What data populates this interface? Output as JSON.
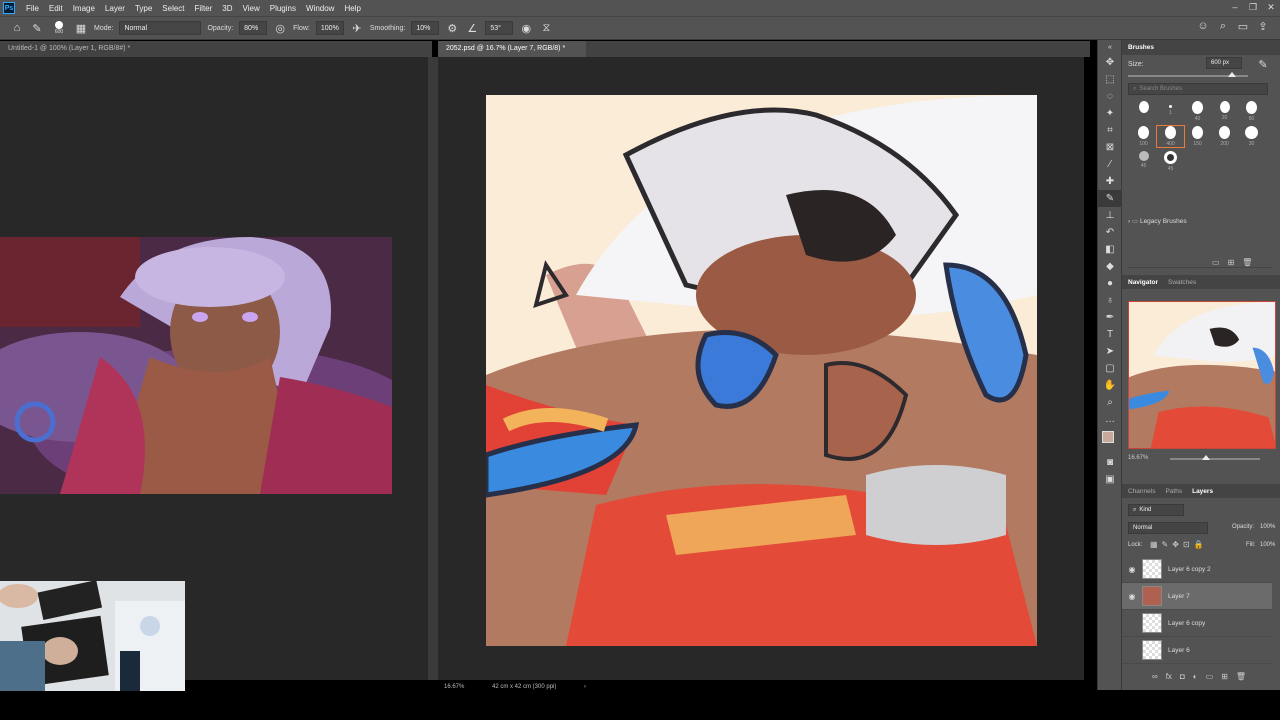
{
  "menu": [
    "File",
    "Edit",
    "Image",
    "Layer",
    "Type",
    "Select",
    "Filter",
    "3D",
    "View",
    "Plugins",
    "Window",
    "Help"
  ],
  "options": {
    "brush_size": "600",
    "mode_label": "Mode:",
    "mode_value": "Normal",
    "opacity_label": "Opacity:",
    "opacity_value": "80%",
    "flow_label": "Flow:",
    "flow_value": "100%",
    "smoothing_label": "Smoothing:",
    "smoothing_value": "10%",
    "angle_value": "53°"
  },
  "tabs": {
    "left": "Untitled-1 @ 100% (Layer 1, RGB/8#) *",
    "main": "2052.psd @ 16.7% (Layer 7, RGB/8) *"
  },
  "status": {
    "zoom": "16.67%",
    "doc_size": "42 cm x 42 cm (300 ppi)"
  },
  "brushes_panel": {
    "title": "Brushes",
    "size_label": "Size:",
    "size_value": "600 px",
    "search_placeholder": "Search Brushes",
    "row1_numbers": [
      "",
      "1",
      "40",
      "20",
      "80"
    ],
    "row2_numbers": [
      "100",
      "400",
      "150",
      "200",
      "30"
    ],
    "row3_numbers": [
      "45",
      "45"
    ],
    "folder": "Legacy Brushes"
  },
  "navigator_panel": {
    "tabs": [
      "Navigator",
      "Swatches"
    ],
    "zoom": "16.67%"
  },
  "layers_panel": {
    "tabs": [
      "Channels",
      "Paths",
      "Layers"
    ],
    "filter": "Kind",
    "blend": "Normal",
    "opacity_label": "Opacity:",
    "opacity_value": "100%",
    "lock_label": "Lock:",
    "fill_label": "Fill:",
    "fill_value": "100%",
    "layers": [
      {
        "name": "Layer 6 copy 2",
        "visible": true
      },
      {
        "name": "Layer 7",
        "visible": true,
        "selected": true
      },
      {
        "name": "Layer 6 copy",
        "visible": false
      },
      {
        "name": "Layer 6",
        "visible": false
      }
    ]
  },
  "colors": {
    "ui_bg": "#535353",
    "canvas_bg": "#282828",
    "artwork_bg": "#fbecd8",
    "foreground_swatch": "#c7a89a",
    "background_swatch": "#e5d6cf"
  }
}
